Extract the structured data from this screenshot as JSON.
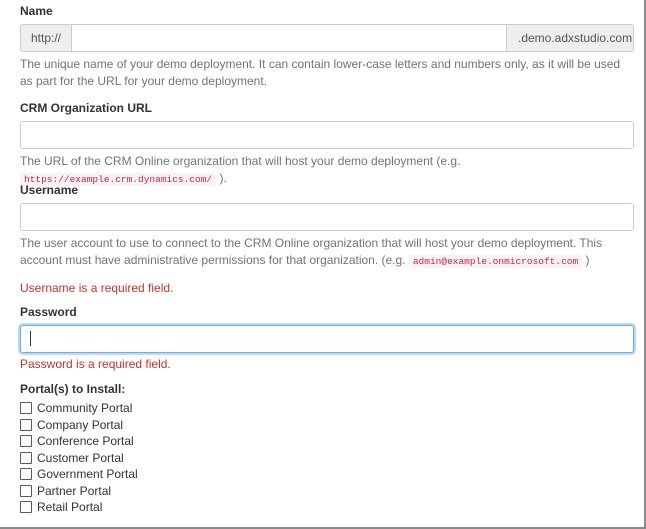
{
  "name": {
    "label": "Name",
    "prefix": "http://",
    "suffix": ".demo.adxstudio.com",
    "value": "",
    "help": "The unique name of your demo deployment. It can contain lower-case letters and numbers only, as it will be used as part for the URL for your demo deployment."
  },
  "crm_url": {
    "label": "CRM Organization URL",
    "value": "",
    "help_prefix": "The URL of the CRM Online organization that will host your demo deployment (e.g. ",
    "help_code": "https://example.crm.dynamics.com/",
    "help_suffix": " )."
  },
  "username": {
    "label": "Username",
    "value": "",
    "help_prefix": "The user account to use to connect to the CRM Online organization that will host your demo deployment. This account must have administrative permissions for that organization. (e.g. ",
    "help_code": "admin@example.onmicrosoft.com",
    "help_suffix": " )",
    "error": "Username is a required field."
  },
  "password": {
    "label": "Password",
    "value": "",
    "error": "Password is a required field."
  },
  "portals": {
    "label": "Portal(s) to Install:",
    "items": [
      {
        "label": "Community Portal",
        "checked": false
      },
      {
        "label": "Company Portal",
        "checked": false
      },
      {
        "label": "Conference Portal",
        "checked": false
      },
      {
        "label": "Customer Portal",
        "checked": false
      },
      {
        "label": "Government Portal",
        "checked": false
      },
      {
        "label": "Partner Portal",
        "checked": false
      },
      {
        "label": "Retail Portal",
        "checked": false
      }
    ]
  },
  "colors": {
    "error": "#c9302c",
    "focus": "#66afe9",
    "code": "#c7254e"
  }
}
